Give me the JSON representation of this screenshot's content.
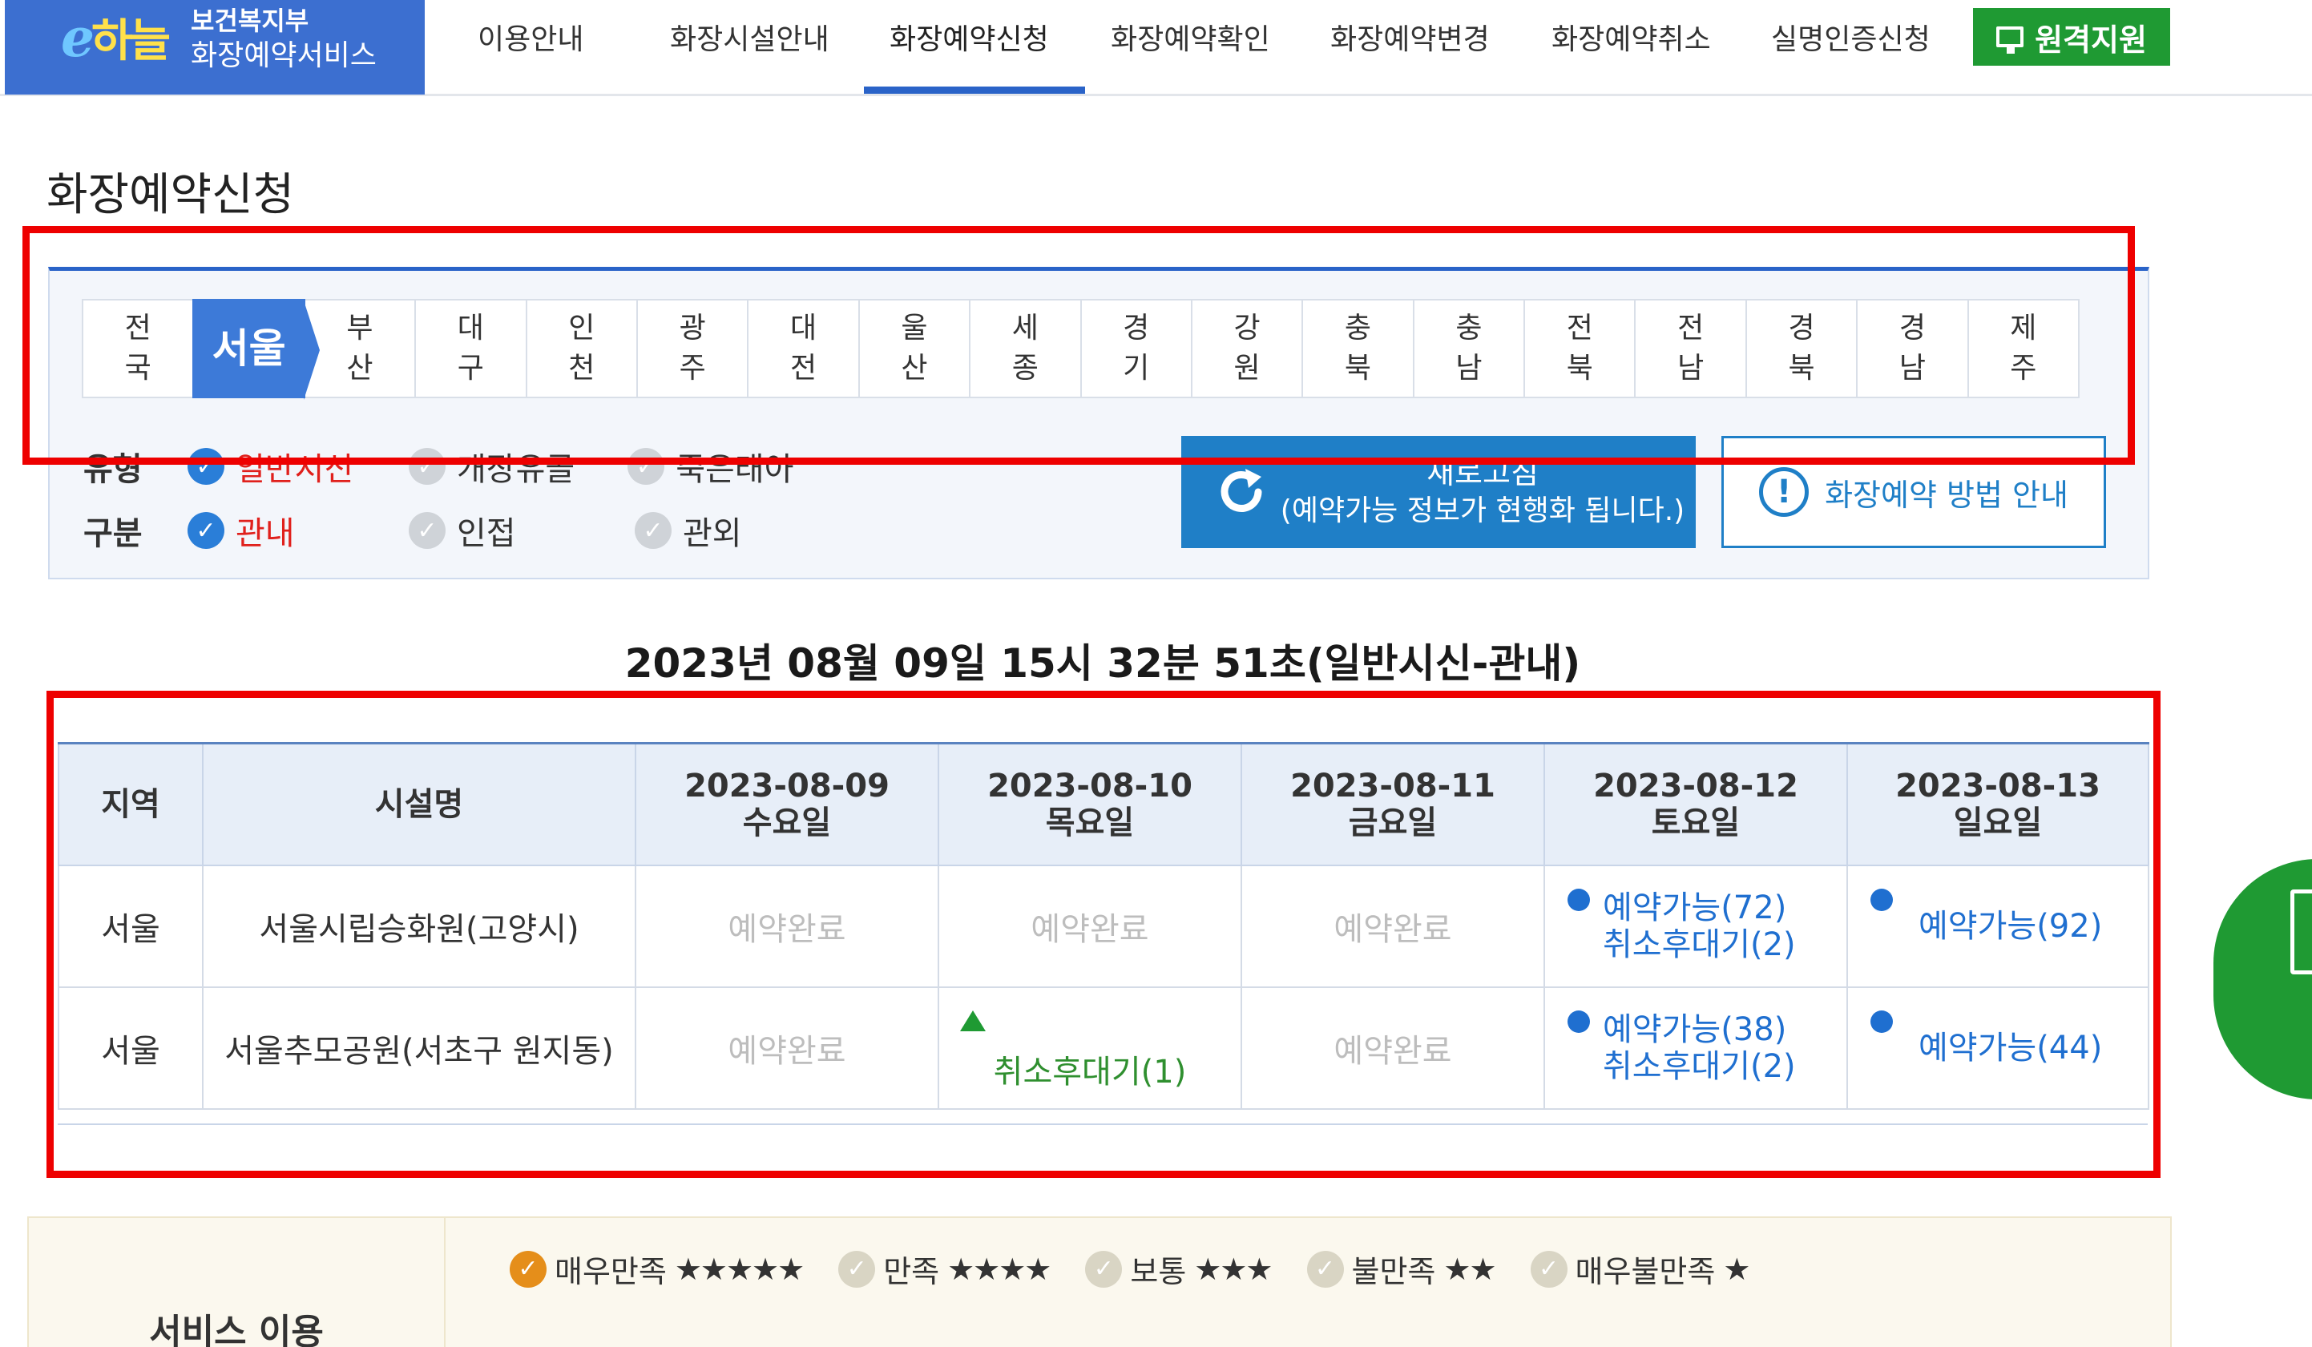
{
  "header": {
    "logo_mark_e": "e",
    "logo_mark_ha": "하늘",
    "logo_line1": "보건복지부",
    "logo_line2": "화장예약서비스",
    "nav": [
      {
        "label": "이용안내"
      },
      {
        "label": "화장시설안내"
      },
      {
        "label": "화장예약신청"
      },
      {
        "label": "화장예약확인"
      },
      {
        "label": "화장예약변경"
      },
      {
        "label": "화장예약취소"
      },
      {
        "label": "실명인증신청"
      }
    ],
    "active_nav": "화장예약신청",
    "remote_label": "원격지원",
    "remote_icon": "monitor-icon"
  },
  "page_title": "화장예약신청",
  "regions": [
    {
      "top": "전",
      "bottom": "국"
    },
    {
      "label": "서울"
    },
    {
      "top": "부",
      "bottom": "산"
    },
    {
      "top": "대",
      "bottom": "구"
    },
    {
      "top": "인",
      "bottom": "천"
    },
    {
      "top": "광",
      "bottom": "주"
    },
    {
      "top": "대",
      "bottom": "전"
    },
    {
      "top": "울",
      "bottom": "산"
    },
    {
      "top": "세",
      "bottom": "종"
    },
    {
      "top": "경",
      "bottom": "기"
    },
    {
      "top": "강",
      "bottom": "원"
    },
    {
      "top": "충",
      "bottom": "북"
    },
    {
      "top": "충",
      "bottom": "남"
    },
    {
      "top": "전",
      "bottom": "북"
    },
    {
      "top": "전",
      "bottom": "남"
    },
    {
      "top": "경",
      "bottom": "북"
    },
    {
      "top": "경",
      "bottom": "남"
    },
    {
      "top": "제",
      "bottom": "주"
    }
  ],
  "selected_region": "서울",
  "type_row": {
    "label": "유형",
    "options": [
      {
        "label": "일반시신",
        "checked": true
      },
      {
        "label": "개장유골",
        "checked": false
      },
      {
        "label": "죽은태아",
        "checked": false
      }
    ]
  },
  "scope_row": {
    "label": "구분",
    "options": [
      {
        "label": "관내",
        "checked": true
      },
      {
        "label": "인접",
        "checked": false
      },
      {
        "label": "관외",
        "checked": false
      }
    ]
  },
  "refresh": {
    "line1": "새로고침",
    "line2": "(예약가능 정보가 현행화 됩니다.)",
    "icon": "refresh-icon"
  },
  "guide": {
    "label": "화장예약 방법 안내",
    "icon": "exclamation-icon"
  },
  "headline": "2023년 08월 09일 15시 32분 51초(일반시신-관내)",
  "table": {
    "col_region": "지역",
    "col_facility": "시설명",
    "dates": [
      {
        "date": "2023-08-09",
        "weekday": "수요일"
      },
      {
        "date": "2023-08-10",
        "weekday": "목요일"
      },
      {
        "date": "2023-08-11",
        "weekday": "금요일"
      },
      {
        "date": "2023-08-12",
        "weekday": "토요일"
      },
      {
        "date": "2023-08-13",
        "weekday": "일요일"
      }
    ],
    "rows": [
      {
        "region": "서울",
        "facility": "서울시립승화원(고양시)",
        "cells": [
          {
            "status": "예약완료"
          },
          {
            "status": "예약완료"
          },
          {
            "status": "예약완료"
          },
          {
            "avail": "예약가능(72)",
            "wait": "취소후대기(2)"
          },
          {
            "avail": "예약가능(92)"
          }
        ]
      },
      {
        "region": "서울",
        "facility": "서울추모공원(서초구 원지동)",
        "cells": [
          {
            "status": "예약완료"
          },
          {
            "wait_only": "취소후대기(1)"
          },
          {
            "status": "예약완료"
          },
          {
            "avail": "예약가능(38)",
            "wait": "취소후대기(2)"
          },
          {
            "avail": "예약가능(44)"
          }
        ]
      }
    ]
  },
  "survey": {
    "label": "서비스 이용",
    "options": [
      {
        "label": "매우만족",
        "stars": "★★★★★",
        "checked": true
      },
      {
        "label": "만족",
        "stars": "★★★★",
        "checked": false
      },
      {
        "label": "보통",
        "stars": "★★★",
        "checked": false
      },
      {
        "label": "불만족",
        "stars": "★★",
        "checked": false
      },
      {
        "label": "매우불만족",
        "stars": "★",
        "checked": false
      }
    ]
  },
  "colors": {
    "brand_blue": "#3c6fd0",
    "accent_blue": "#2a63c8",
    "remote_green": "#1f9a33",
    "highlight_red": "#ee0000",
    "available_blue": "#1f6fd0",
    "wait_green": "#2f8f2f",
    "done_gray": "#bdbdbd"
  }
}
